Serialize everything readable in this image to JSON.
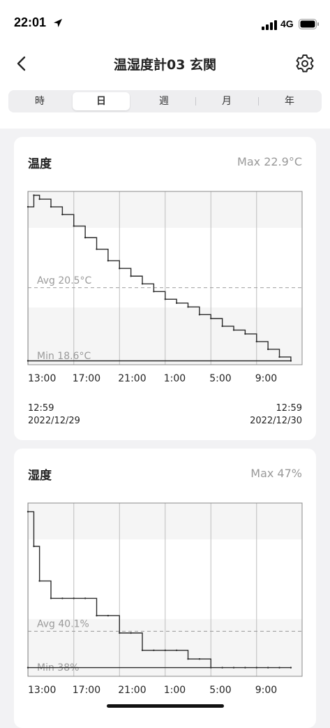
{
  "status_bar": {
    "time": "22:01",
    "network": "4G"
  },
  "header": {
    "title": "温湿度計03 玄関"
  },
  "tabs": [
    {
      "label": "時",
      "selected": false
    },
    {
      "label": "日",
      "selected": true
    },
    {
      "label": "週",
      "selected": false
    },
    {
      "label": "月",
      "selected": false
    },
    {
      "label": "年",
      "selected": false
    }
  ],
  "temperature": {
    "title": "温度",
    "max_label": "Max 22.9°C",
    "avg_label": "Avg 20.5°C",
    "min_label": "Min 18.6°C",
    "x_ticks": [
      "13:00",
      "17:00",
      "21:00",
      "1:00",
      "5:00",
      "9:00"
    ],
    "start_time": "12:59",
    "start_date": "2022/12/29",
    "end_time": "12:59",
    "end_date": "2022/12/30"
  },
  "humidity": {
    "title": "湿度",
    "max_label": "Max 47%",
    "avg_label": "Avg 40.1%",
    "min_label": "Min 38%",
    "x_ticks": [
      "13:00",
      "17:00",
      "21:00",
      "1:00",
      "5:00",
      "9:00"
    ]
  },
  "chart_data": [
    {
      "type": "line",
      "title": "温度",
      "unit": "°C",
      "x": [
        "12:59",
        "13:30",
        "14:00",
        "15:00",
        "16:00",
        "17:00",
        "18:00",
        "19:00",
        "20:00",
        "21:00",
        "22:00",
        "23:00",
        "0:00",
        "1:00",
        "2:00",
        "3:00",
        "4:00",
        "5:00",
        "6:00",
        "7:00",
        "8:00",
        "9:00",
        "10:00",
        "11:00",
        "12:00",
        "12:59"
      ],
      "values": [
        22.6,
        22.9,
        22.8,
        22.6,
        22.4,
        22.1,
        21.8,
        21.5,
        21.2,
        21.0,
        20.8,
        20.6,
        20.4,
        20.2,
        20.1,
        20.0,
        19.8,
        19.7,
        19.5,
        19.4,
        19.3,
        19.1,
        18.9,
        18.7,
        18.6,
        18.6
      ],
      "max": 22.9,
      "avg": 20.5,
      "min": 18.6,
      "ylim": [
        18.5,
        23.0
      ]
    },
    {
      "type": "line",
      "title": "湿度",
      "unit": "%",
      "x": [
        "12:59",
        "13:30",
        "14:00",
        "15:00",
        "16:00",
        "17:00",
        "18:00",
        "19:00",
        "20:00",
        "21:00",
        "22:00",
        "23:00",
        "0:00",
        "1:00",
        "2:00",
        "3:00",
        "4:00",
        "5:00",
        "6:00",
        "7:00",
        "8:00",
        "9:00",
        "10:00",
        "11:00",
        "12:00",
        "12:59"
      ],
      "values": [
        47,
        45,
        43,
        42,
        42,
        42,
        42,
        41,
        41,
        40,
        40,
        39,
        39,
        39,
        39,
        38.5,
        38.5,
        38,
        38,
        38,
        38,
        38,
        38,
        38,
        38,
        38
      ],
      "max": 47,
      "avg": 40.1,
      "min": 38,
      "ylim": [
        37.5,
        47.5
      ]
    }
  ]
}
